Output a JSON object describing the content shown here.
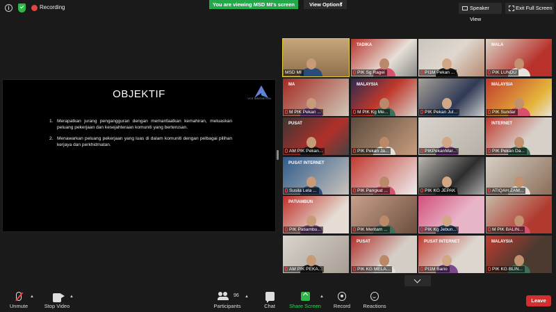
{
  "topbar": {
    "recording_label": "Recording",
    "viewing_banner": "You are viewing MSD MI's screen",
    "view_options_label": "View Options",
    "speaker_view_label": "Speaker View",
    "exit_full_screen_label": "Exit Full Screen"
  },
  "slide": {
    "title": "OBJEKTIF",
    "logo_text": "VCS INNOVATION",
    "points": [
      {
        "num": "1.",
        "text": "Merapatkan jurang pengangguran dengan memanfaatkan kemahiran, meluaskan peluang pekerjaan dan kesejahteraan komuniti yang berterusan."
      },
      {
        "num": "2.",
        "text": "Menawarkan peluang pekerjaan yang luas di dalam komuniti dengan pelbagai pilihan kerjaya dan perkhidmatan."
      }
    ]
  },
  "participants": [
    {
      "name": "MSD MI",
      "muted": false,
      "active": true
    },
    {
      "name": "PIK Sg Ragei",
      "muted": true
    },
    {
      "name": "PI1M Pekan ...",
      "muted": true
    },
    {
      "name": "PIK LUNDU",
      "muted": true
    },
    {
      "name": "M PIK Pekan ...",
      "muted": true
    },
    {
      "name": "M PIK Kg Me...",
      "muted": true
    },
    {
      "name": "PIK Pekan Jul...",
      "muted": true
    },
    {
      "name": "PIK Sundar",
      "muted": true
    },
    {
      "name": "AM PIK Pekan...",
      "muted": true
    },
    {
      "name": "PIK Pekan Ja...",
      "muted": true
    },
    {
      "name": "PIKPekanMar...",
      "muted": true
    },
    {
      "name": "PIK Pekan Da...",
      "muted": true
    },
    {
      "name": "Susila Lela ...",
      "muted": true
    },
    {
      "name": "PIK Pangkat ...",
      "muted": true
    },
    {
      "name": "PIK KG JEPAK",
      "muted": true
    },
    {
      "name": "ATIQAH ZAM...",
      "muted": true
    },
    {
      "name": "PIK Patiambu...",
      "muted": true
    },
    {
      "name": "PIK Meritam ...",
      "muted": true
    },
    {
      "name": "PIK Kg Jebun...",
      "muted": true
    },
    {
      "name": "M PIK BALIN...",
      "muted": true
    },
    {
      "name": "AM PIK PEKA...",
      "muted": true
    },
    {
      "name": "PIK KG MELA...",
      "muted": true
    },
    {
      "name": "PI1M Bario",
      "muted": true
    },
    {
      "name": "PIK KG BLIN...",
      "muted": true
    }
  ],
  "tile_signs": {
    "t1": "TADIKA",
    "t3": "MALA",
    "t4": "MA",
    "t5": "MALAYSIA",
    "t7": "MALAYSIA",
    "t8": "PUSAT",
    "t11": "INTERNET",
    "t12": "PUSAT INTERNET",
    "t16": "PATIAMBUN",
    "t21": "PUSAT",
    "t22": "PUSAT INTERNET",
    "t23": "MALAYSIA"
  },
  "toolbar": {
    "unmute_label": "Unmute",
    "stop_video_label": "Stop Video",
    "participants_label": "Participants",
    "participants_count": "96",
    "chat_label": "Chat",
    "share_screen_label": "Share Screen",
    "record_label": "Record",
    "reactions_label": "Reactions",
    "leave_label": "Leave"
  },
  "colors": {
    "accent_green": "#23a84a",
    "leave_red": "#d32f2f",
    "active_speaker": "#e7d23a"
  }
}
